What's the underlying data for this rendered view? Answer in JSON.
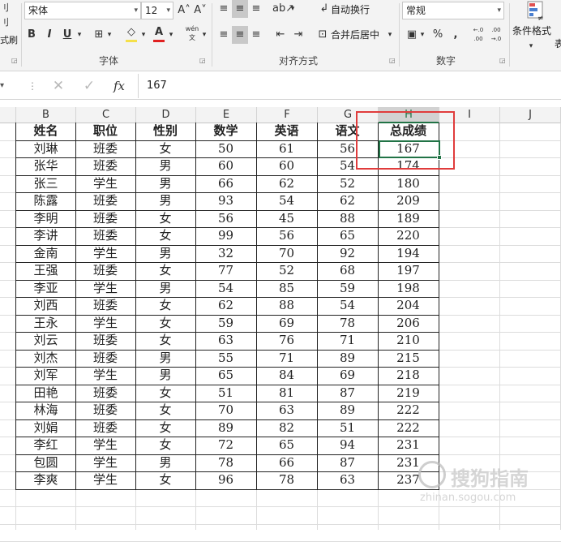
{
  "ribbon": {
    "left_fragments": [
      "刂",
      "刂",
      "式刷"
    ],
    "font_name": "宋体",
    "font_size": "12",
    "grow_font": "A˄",
    "shrink_font": "A˅",
    "bold": "B",
    "italic": "I",
    "underline": "U",
    "phonetic": "wén 文",
    "font_group_label": "字体",
    "wrap_text_label": "自动换行",
    "merge_center_label": "合并后居中",
    "alignment_group_label": "对齐方式",
    "number_format": "常规",
    "percent": "%",
    "comma": ",",
    "inc_decimal": "←.0 .00",
    "dec_decimal": ".00 →.0",
    "number_group_label": "数字",
    "cond_format_label": "条件格式",
    "cut_fragment": "表"
  },
  "formula_bar": {
    "fx": "fx",
    "value": "167"
  },
  "sheet": {
    "columns": [
      "B",
      "C",
      "D",
      "E",
      "F",
      "G",
      "H",
      "I",
      "J"
    ],
    "selected_column": "H",
    "header": [
      "姓名",
      "职位",
      "性别",
      "数学",
      "英语",
      "语文",
      "总成绩"
    ],
    "rows": [
      [
        "刘琳",
        "班委",
        "女",
        "50",
        "61",
        "56",
        "167"
      ],
      [
        "张华",
        "班委",
        "男",
        "60",
        "60",
        "54",
        "174"
      ],
      [
        "张三",
        "学生",
        "男",
        "66",
        "62",
        "52",
        "180"
      ],
      [
        "陈露",
        "班委",
        "男",
        "93",
        "54",
        "62",
        "209"
      ],
      [
        "李明",
        "班委",
        "女",
        "56",
        "45",
        "88",
        "189"
      ],
      [
        "李讲",
        "班委",
        "女",
        "99",
        "56",
        "65",
        "220"
      ],
      [
        "金南",
        "学生",
        "男",
        "32",
        "70",
        "92",
        "194"
      ],
      [
        "王强",
        "班委",
        "女",
        "77",
        "52",
        "68",
        "197"
      ],
      [
        "李亚",
        "学生",
        "男",
        "54",
        "85",
        "59",
        "198"
      ],
      [
        "刘西",
        "班委",
        "女",
        "62",
        "88",
        "54",
        "204"
      ],
      [
        "王永",
        "学生",
        "女",
        "59",
        "69",
        "78",
        "206"
      ],
      [
        "刘云",
        "班委",
        "女",
        "63",
        "76",
        "71",
        "210"
      ],
      [
        "刘杰",
        "班委",
        "男",
        "55",
        "71",
        "89",
        "215"
      ],
      [
        "刘军",
        "学生",
        "男",
        "65",
        "84",
        "69",
        "218"
      ],
      [
        "田艳",
        "班委",
        "女",
        "51",
        "81",
        "87",
        "219"
      ],
      [
        "林海",
        "班委",
        "女",
        "70",
        "63",
        "89",
        "222"
      ],
      [
        "刘娟",
        "班委",
        "女",
        "89",
        "82",
        "51",
        "222"
      ],
      [
        "李红",
        "学生",
        "女",
        "72",
        "65",
        "94",
        "231"
      ],
      [
        "包圆",
        "学生",
        "男",
        "78",
        "66",
        "87",
        "231"
      ],
      [
        "李爽",
        "学生",
        "女",
        "96",
        "78",
        "63",
        "237"
      ]
    ]
  },
  "watermark": {
    "main": "搜狗指南",
    "sub": "zhinan.sogou.com"
  },
  "colors": {
    "selection": "#217346",
    "highlight_box": "#e03c3c"
  }
}
